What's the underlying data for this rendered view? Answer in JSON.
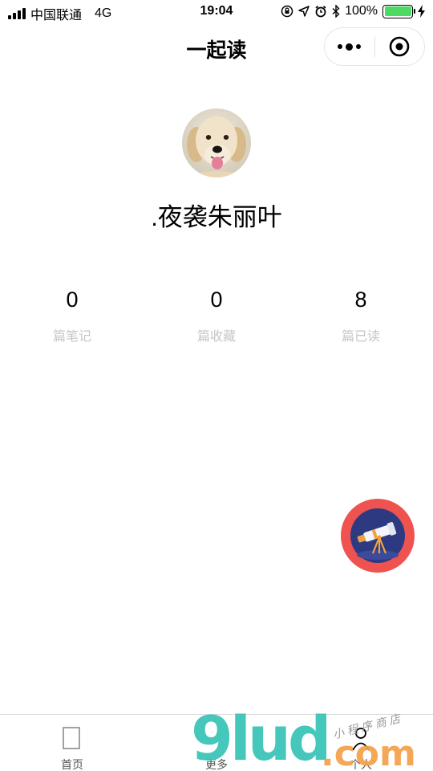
{
  "status_bar": {
    "carrier": "中国联通",
    "network": "4G",
    "time": "19:04",
    "battery_percent": "100%",
    "battery_level": 1.0,
    "icons": [
      "signal-icon",
      "lock-rotation-icon",
      "location-icon",
      "alarm-icon",
      "bluetooth-icon",
      "battery-icon",
      "charging-icon"
    ]
  },
  "nav": {
    "title": "一起读",
    "capsule_icons": [
      "more-dots-icon",
      "close-target-icon"
    ]
  },
  "profile": {
    "avatar_icon": "avatar-dog-photo",
    "username": ".夜袭朱丽叶"
  },
  "stats": [
    {
      "value": "0",
      "label": "篇笔记"
    },
    {
      "value": "0",
      "label": "篇收藏"
    },
    {
      "value": "8",
      "label": "篇已读"
    }
  ],
  "fab": {
    "icon": "telescope-icon",
    "color": "#ef5350"
  },
  "tabs": [
    {
      "label": "首页",
      "icon": "home-icon"
    },
    {
      "label": "更多",
      "icon": "more-icon"
    },
    {
      "label": "个人",
      "icon": "person-icon"
    }
  ],
  "watermark": {
    "main": "9lud",
    "suffix": ".com",
    "subtitle": "小程序商店"
  },
  "colors": {
    "accent_red": "#ef5350",
    "battery_green": "#4cd964",
    "muted_label": "#c6c6c6",
    "watermark_teal": "#36c3b6",
    "watermark_orange": "#f5a04a"
  }
}
